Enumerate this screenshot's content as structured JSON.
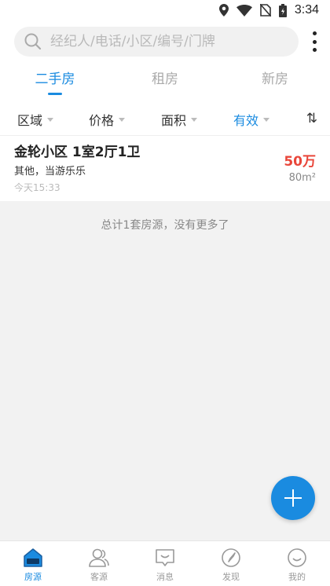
{
  "status_bar": {
    "time": "3:34"
  },
  "search": {
    "placeholder": "经纪人/电话/小区/编号/门牌"
  },
  "tabs": [
    {
      "label": "二手房",
      "active": true
    },
    {
      "label": "租房",
      "active": false
    },
    {
      "label": "新房",
      "active": false
    }
  ],
  "filters": [
    {
      "label": "区域"
    },
    {
      "label": "价格"
    },
    {
      "label": "面积"
    },
    {
      "label": "有效",
      "active": true
    }
  ],
  "sort_icon": "⇅",
  "listing": {
    "title": "金轮小区  1室2厅1卫",
    "description": "其他，当游乐乐",
    "time": "今天15:33",
    "price": "50万",
    "area": "80m²"
  },
  "end_note": "总计1套房源，没有更多了",
  "bottom_nav": [
    {
      "label": "房源",
      "icon": "house-icon",
      "active": true
    },
    {
      "label": "客源",
      "icon": "people-icon"
    },
    {
      "label": "消息",
      "icon": "message-icon"
    },
    {
      "label": "发现",
      "icon": "compass-icon"
    },
    {
      "label": "我的",
      "icon": "smile-icon"
    }
  ],
  "colors": {
    "accent": "#1a8be0",
    "price": "#e9463a"
  }
}
